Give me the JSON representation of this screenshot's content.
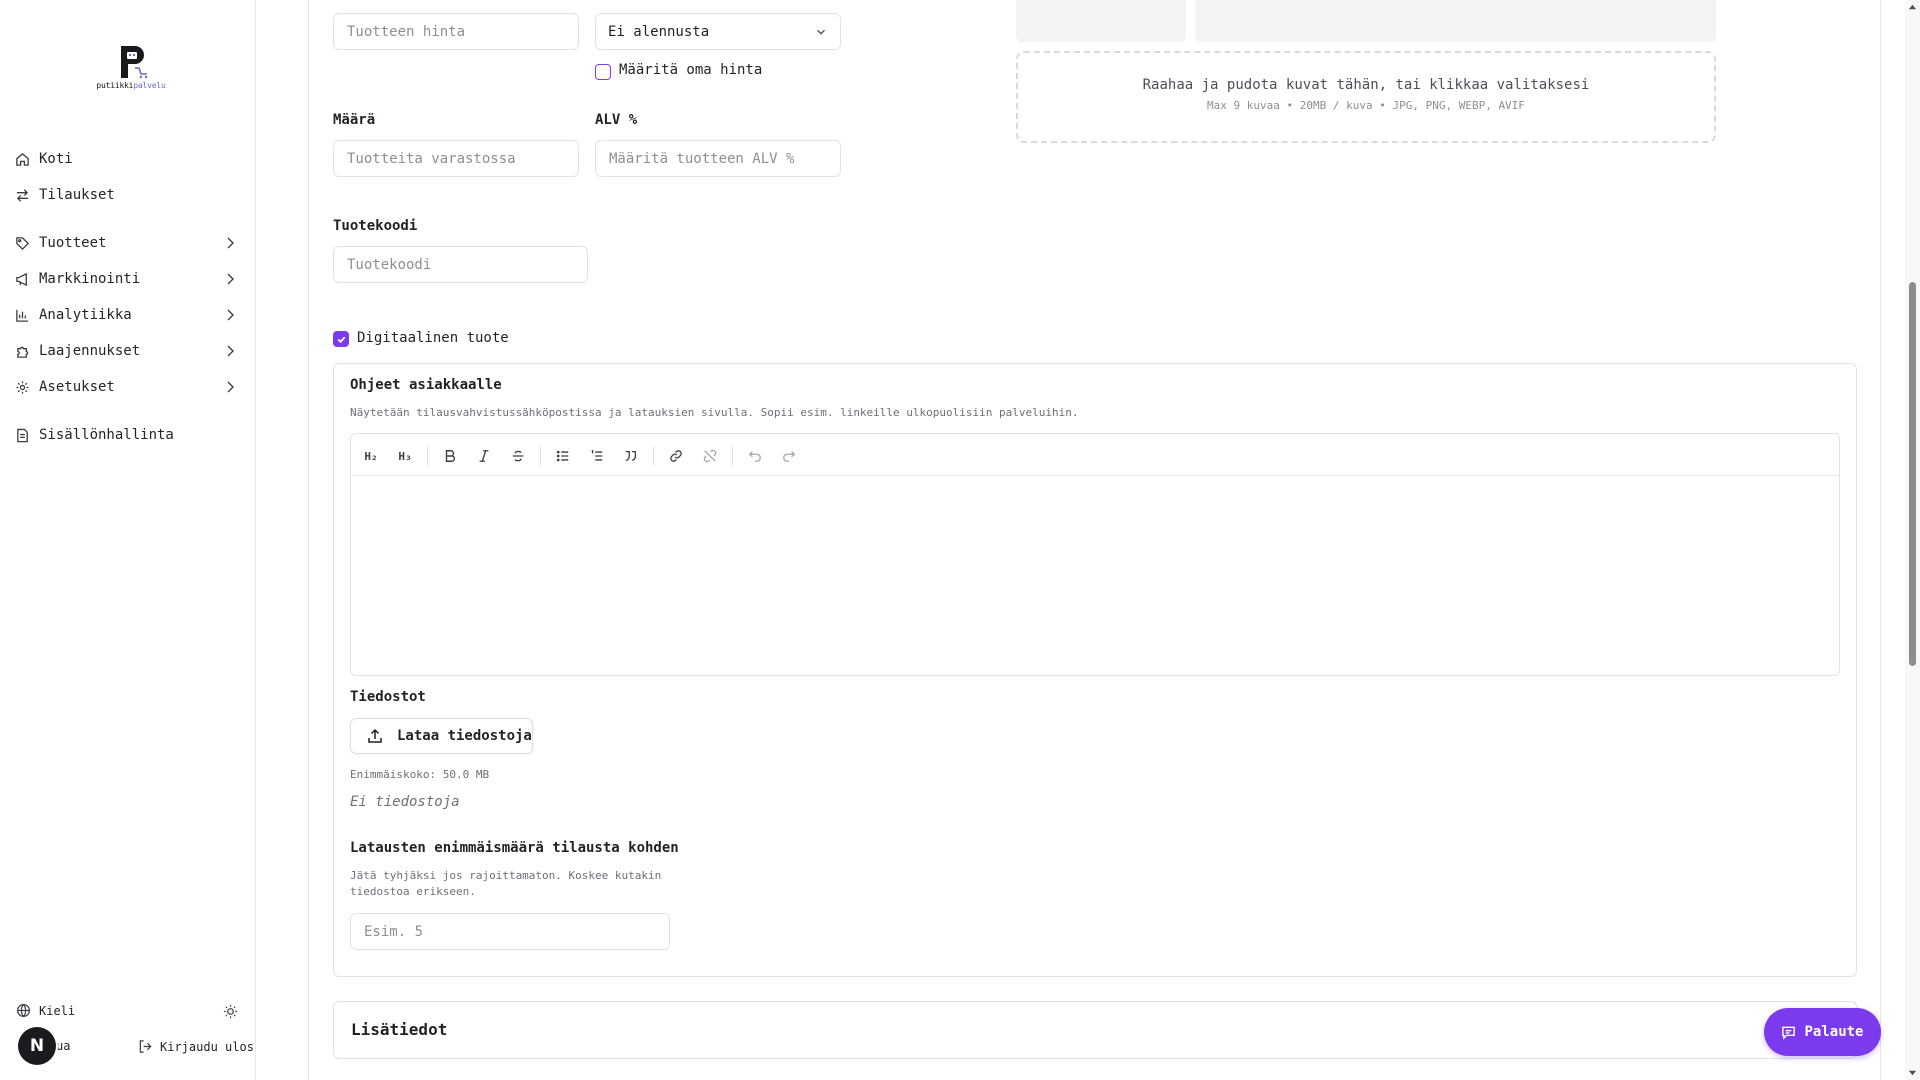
{
  "brand": {
    "logo_letter": "P",
    "logo_text_a": "putiikki",
    "logo_text_b": "palvelu",
    "accent": "#7c3aed"
  },
  "sidebar": {
    "items": [
      {
        "label": "Koti",
        "icon": "home-icon",
        "has_chevron": false
      },
      {
        "label": "Tilaukset",
        "icon": "arrows-swap-icon",
        "has_chevron": false
      },
      {
        "label": "Tuotteet",
        "icon": "tag-icon",
        "has_chevron": true
      },
      {
        "label": "Markkinointi",
        "icon": "megaphone-icon",
        "has_chevron": true
      },
      {
        "label": "Analytiikka",
        "icon": "bar-chart-icon",
        "has_chevron": true
      },
      {
        "label": "Laajennukset",
        "icon": "puzzle-icon",
        "has_chevron": true
      },
      {
        "label": "Asetukset",
        "icon": "gear-icon",
        "has_chevron": true
      },
      {
        "label": "Sisällönhallinta",
        "icon": "document-icon",
        "has_chevron": false
      }
    ],
    "language_label": "Kieli",
    "help_label_partial": "ua",
    "logout_label": "Kirjaudu ulos",
    "avatar_initial": "N"
  },
  "form": {
    "price_placeholder": "Tuotteen hinta",
    "discount_selected": "Ei alennusta",
    "custom_price_label": "Määritä oma hinta",
    "quantity_label": "Määrä",
    "quantity_placeholder": "Tuotteita varastossa",
    "vat_label": "ALV %",
    "vat_placeholder": "Määritä tuotteen ALV %",
    "sku_label": "Tuotekoodi",
    "sku_placeholder": "Tuotekoodi",
    "digital_label": "Digitaalinen tuote",
    "digital_checked": true,
    "custom_price_checked": false
  },
  "media": {
    "dropzone_text": "Raahaa ja pudota kuvat tähän, tai klikkaa valitaksesi",
    "dropzone_hint": "Max 9 kuvaa • 20MB / kuva • JPG, PNG, WEBP, AVIF"
  },
  "digital": {
    "instructions_title": "Ohjeet asiakkaalle",
    "instructions_help": "Näytetään tilausvahvistussähköpostissa ja latauksien sivulla. Sopii esim. linkeille ulkopuolisiin palveluihin.",
    "toolbar": [
      "heading-2-icon",
      "heading-3-icon",
      "bold-icon",
      "italic-icon",
      "strikethrough-icon",
      "bullet-list-icon",
      "ordered-list-icon",
      "quote-icon",
      "link-icon",
      "unlink-icon",
      "undo-icon",
      "redo-icon"
    ],
    "files_title": "Tiedostot",
    "upload_button": "Lataa tiedostoja",
    "max_size": "Enimmäiskoko: 50.0 MB",
    "no_files": "Ei tiedostoja",
    "download_limit_title": "Latausten enimmäismäärä tilausta kohden",
    "download_limit_help_1": "Jätä tyhjäksi jos rajoittamaton. Koskee kutakin",
    "download_limit_help_2": "tiedostoa erikseen.",
    "download_limit_placeholder": "Esim. 5"
  },
  "extra_section": {
    "title": "Lisätiedot"
  },
  "feedback": {
    "label": "Palaute"
  }
}
